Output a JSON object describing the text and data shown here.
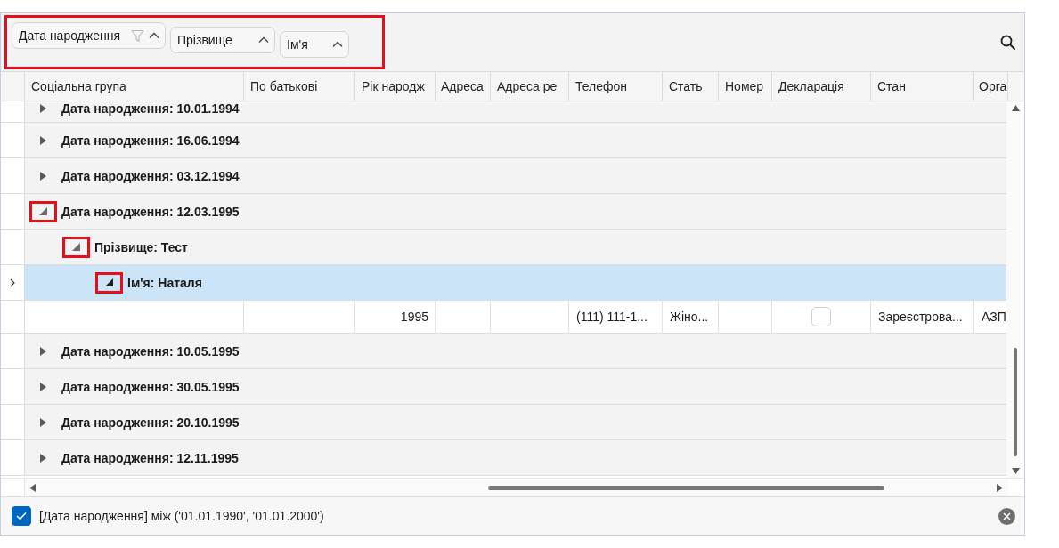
{
  "group_panel": {
    "highlighted": true,
    "chips": [
      {
        "label": "Дата народження",
        "filtered": true,
        "ascending": true
      },
      {
        "label": "Прізвище",
        "filtered": false,
        "ascending": true
      },
      {
        "label": "Ім'я",
        "filtered": false,
        "ascending": true
      }
    ]
  },
  "table": {
    "columns": [
      {
        "label": "Соціальна група"
      },
      {
        "label": "По батькові"
      },
      {
        "label": "Рік народж"
      },
      {
        "label": "Адреса"
      },
      {
        "label": "Адреса ре"
      },
      {
        "label": "Телефон"
      },
      {
        "label": "Стать"
      },
      {
        "label": "Номер"
      },
      {
        "label": "Декларація"
      },
      {
        "label": "Стан"
      },
      {
        "label": "Орга"
      }
    ],
    "rows": [
      {
        "kind": "group",
        "label": "Дата народження: 10.01.1994",
        "expanded": false,
        "selected": false,
        "highlighted": false
      },
      {
        "kind": "group",
        "label": "Дата народження: 16.06.1994",
        "expanded": false,
        "selected": false,
        "highlighted": false
      },
      {
        "kind": "group",
        "label": "Дата народження: 03.12.1994",
        "expanded": false,
        "selected": false,
        "highlighted": false
      },
      {
        "kind": "group",
        "label": "Дата народження: 12.03.1995",
        "expanded": true,
        "selected": false,
        "highlighted": true,
        "children": [
          {
            "kind": "group",
            "label": "Прізвище: Тест",
            "expanded": true,
            "selected": false,
            "highlighted": true,
            "children": [
              {
                "kind": "group",
                "label": "Ім'я: Наталя",
                "expanded": true,
                "selected": true,
                "highlighted": true,
                "children": [
                  {
                    "kind": "data",
                    "selected": false,
                    "cells": [
                      null,
                      null,
                      {
                        "kind": "number",
                        "text": "1995"
                      },
                      null,
                      null,
                      {
                        "kind": "text",
                        "text": "(111) 111-1..."
                      },
                      {
                        "kind": "text",
                        "text": "Жіно..."
                      },
                      null,
                      {
                        "kind": "checkbox",
                        "checked": false
                      },
                      {
                        "kind": "text",
                        "text": "Зареєстрова..."
                      },
                      {
                        "kind": "text",
                        "text": "АЗП"
                      }
                    ]
                  }
                ]
              }
            ]
          }
        ]
      },
      {
        "kind": "group",
        "label": "Дата народження: 10.05.1995",
        "expanded": false,
        "selected": false,
        "highlighted": false
      },
      {
        "kind": "group",
        "label": "Дата народження: 30.05.1995",
        "expanded": false,
        "selected": false,
        "highlighted": false
      },
      {
        "kind": "group",
        "label": "Дата народження: 20.10.1995",
        "expanded": false,
        "selected": false,
        "highlighted": false
      },
      {
        "kind": "group",
        "label": "Дата народження: 12.11.1995",
        "expanded": false,
        "selected": false,
        "highlighted": false
      }
    ]
  },
  "filter_bar": {
    "enabled": true,
    "text": "[Дата народження] між ('01.01.1990', '01.01.2000')"
  }
}
